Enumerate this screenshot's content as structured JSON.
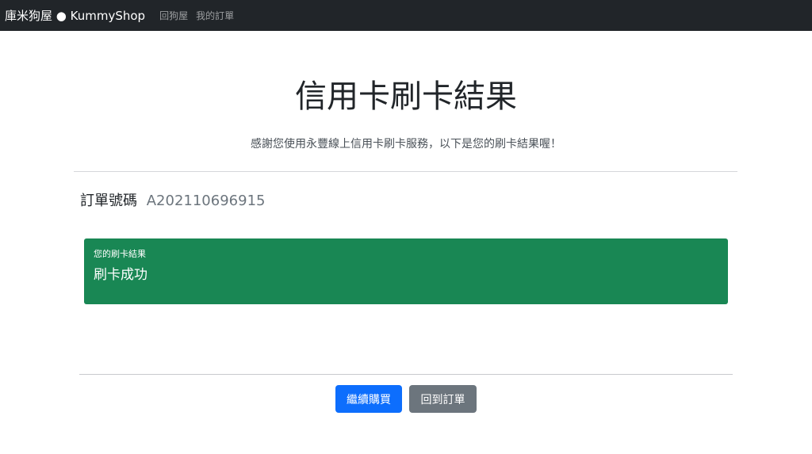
{
  "navbar": {
    "brand": "庫米狗屋 ● KummyShop",
    "links": [
      "回狗屋",
      "我的訂單"
    ]
  },
  "main": {
    "title": "信用卡刷卡結果",
    "lead": "感謝您使用永豐線上信用卡刷卡服務，以下是您的刷卡結果喔！",
    "order_label": "訂單號碼",
    "order_number": "A202110696915",
    "result_card": {
      "header": "您的刷卡結果",
      "value": "刷卡成功",
      "color": "#198754"
    }
  },
  "actions": {
    "continue_label": "繼續購買",
    "back_label": "回到訂單",
    "primary_color": "#0d6efd",
    "secondary_color": "#6c757d"
  }
}
